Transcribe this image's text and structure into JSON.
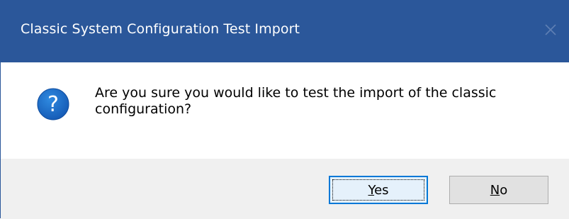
{
  "window": {
    "title": "Classic System Configuration Test Import",
    "close_icon": "close-icon",
    "colors": {
      "titlebar": "#2b579a",
      "title_text": "#ffffff",
      "button_area": "#f0f0f0",
      "icon_fill": "#1c6fc7"
    }
  },
  "message": {
    "icon": "question-icon",
    "text": "Are you sure you would like to test the import of the classic configuration?"
  },
  "buttons": {
    "yes": {
      "mnemonic": "Y",
      "rest": "es",
      "is_default": true
    },
    "no": {
      "mnemonic": "N",
      "rest": "o",
      "is_default": false
    }
  }
}
